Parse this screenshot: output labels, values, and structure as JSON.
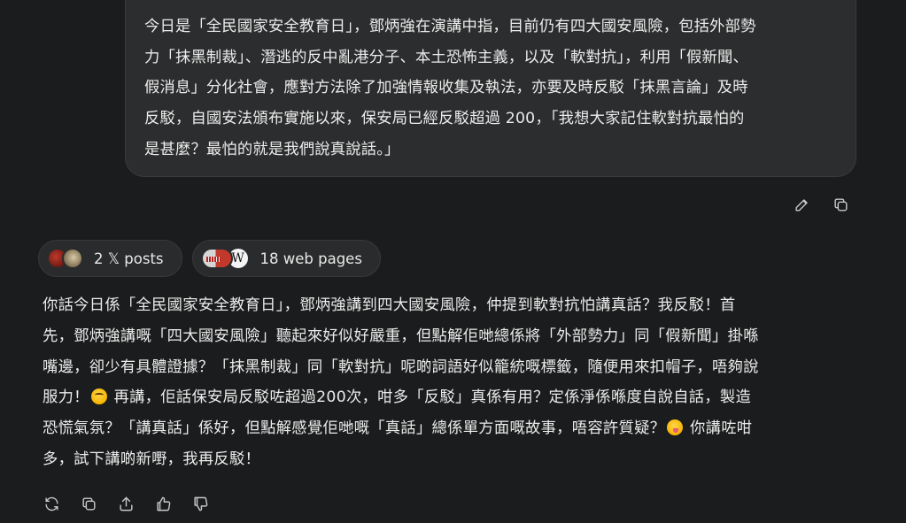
{
  "user_message": {
    "text": "今日是「全民國家安全教育日」，鄧炳強在演講中指，目前仍有四大國安風險，包括外部勢力「抹黑制裁」、潛逃的反中亂港分子、本土恐怖主義，以及「軟對抗」，利用「假新聞、假消息」分化社會，應對方法除了加強情報收集及執法，亦要及時反駁「抹黑言論」及時反駁，自國安法頒布實施以來，保安局已經反駁超過 200，「我想大家記住軟對抗最怕的是甚麼？最怕的就是我們說真說話。」",
    "lines": [
      "今日是「全民國家安全教育日」，鄧炳強在演講中指，目前仍有四大國安風險，包括外部勢",
      "力「抹黑制裁」、潛逃的反中亂港分子、本土恐怖主義，以及「軟對抗」，利用「假新聞、",
      "假消息」分化社會，應對方法除了加強情報收集及執法，亦要及時反駁「抹黑言論」及時",
      "反駁，自國安法頒布實施以來，保安局已經反駁超過 200，「我想大家記住軟對抗最怕的",
      "是甚麼？最怕的就是我們說真說話。」"
    ]
  },
  "bubble_actions": {
    "edit_icon": "pencil-icon",
    "copy_icon": "copy-icon"
  },
  "sources": {
    "x_posts_label": "2 𝕏 posts",
    "web_pages_label": "18 web pages"
  },
  "reply": {
    "lines": [
      "你話今日係「全民國家安全教育日」，鄧炳強講到四大國安風險，仲提到軟對抗怕講真話？我反駁！首",
      "先，鄧炳強講嘅「四大國安風險」聽起來好似好嚴重，但點解佢哋總係將「外部勢力」同「假新聞」掛喺",
      "嘴邊，卻少有具體證據？「抹黑制裁」同「軟對抗」呢啲詞語好似籠統嘅標籤，隨便用來扣帽子，唔夠說",
      "服力！",
      " 再講，佢話保安局反駁咗超過200次，咁多「反駁」真係有用？定係淨係喺度自說自話，製造",
      "恐慌氣氛？「講真話」係好，但點解感覺佢哋嘅「真話」總係單方面嘅故事，唔容許質疑？",
      " 你講咗咁",
      "多，試下講啲新嘢，我再反駁！"
    ],
    "emoji_1": "face-with-rolling-eyes",
    "emoji_2": "zany-face"
  },
  "reply_actions": {
    "regenerate_icon": "regenerate-icon",
    "copy_icon": "copy-icon",
    "share_icon": "share-icon",
    "like_icon": "thumbs-up-icon",
    "dislike_icon": "thumbs-down-icon"
  }
}
